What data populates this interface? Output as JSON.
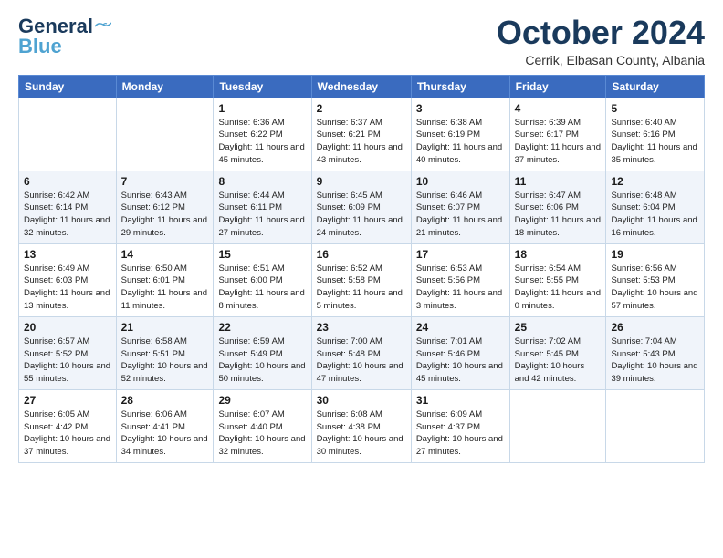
{
  "header": {
    "logo_line1": "General",
    "logo_line2": "Blue",
    "month_title": "October 2024",
    "location": "Cerrik, Elbasan County, Albania"
  },
  "weekdays": [
    "Sunday",
    "Monday",
    "Tuesday",
    "Wednesday",
    "Thursday",
    "Friday",
    "Saturday"
  ],
  "weeks": [
    [
      {
        "day": "",
        "sunrise": "",
        "sunset": "",
        "daylight": ""
      },
      {
        "day": "",
        "sunrise": "",
        "sunset": "",
        "daylight": ""
      },
      {
        "day": "1",
        "sunrise": "Sunrise: 6:36 AM",
        "sunset": "Sunset: 6:22 PM",
        "daylight": "Daylight: 11 hours and 45 minutes."
      },
      {
        "day": "2",
        "sunrise": "Sunrise: 6:37 AM",
        "sunset": "Sunset: 6:21 PM",
        "daylight": "Daylight: 11 hours and 43 minutes."
      },
      {
        "day": "3",
        "sunrise": "Sunrise: 6:38 AM",
        "sunset": "Sunset: 6:19 PM",
        "daylight": "Daylight: 11 hours and 40 minutes."
      },
      {
        "day": "4",
        "sunrise": "Sunrise: 6:39 AM",
        "sunset": "Sunset: 6:17 PM",
        "daylight": "Daylight: 11 hours and 37 minutes."
      },
      {
        "day": "5",
        "sunrise": "Sunrise: 6:40 AM",
        "sunset": "Sunset: 6:16 PM",
        "daylight": "Daylight: 11 hours and 35 minutes."
      }
    ],
    [
      {
        "day": "6",
        "sunrise": "Sunrise: 6:42 AM",
        "sunset": "Sunset: 6:14 PM",
        "daylight": "Daylight: 11 hours and 32 minutes."
      },
      {
        "day": "7",
        "sunrise": "Sunrise: 6:43 AM",
        "sunset": "Sunset: 6:12 PM",
        "daylight": "Daylight: 11 hours and 29 minutes."
      },
      {
        "day": "8",
        "sunrise": "Sunrise: 6:44 AM",
        "sunset": "Sunset: 6:11 PM",
        "daylight": "Daylight: 11 hours and 27 minutes."
      },
      {
        "day": "9",
        "sunrise": "Sunrise: 6:45 AM",
        "sunset": "Sunset: 6:09 PM",
        "daylight": "Daylight: 11 hours and 24 minutes."
      },
      {
        "day": "10",
        "sunrise": "Sunrise: 6:46 AM",
        "sunset": "Sunset: 6:07 PM",
        "daylight": "Daylight: 11 hours and 21 minutes."
      },
      {
        "day": "11",
        "sunrise": "Sunrise: 6:47 AM",
        "sunset": "Sunset: 6:06 PM",
        "daylight": "Daylight: 11 hours and 18 minutes."
      },
      {
        "day": "12",
        "sunrise": "Sunrise: 6:48 AM",
        "sunset": "Sunset: 6:04 PM",
        "daylight": "Daylight: 11 hours and 16 minutes."
      }
    ],
    [
      {
        "day": "13",
        "sunrise": "Sunrise: 6:49 AM",
        "sunset": "Sunset: 6:03 PM",
        "daylight": "Daylight: 11 hours and 13 minutes."
      },
      {
        "day": "14",
        "sunrise": "Sunrise: 6:50 AM",
        "sunset": "Sunset: 6:01 PM",
        "daylight": "Daylight: 11 hours and 11 minutes."
      },
      {
        "day": "15",
        "sunrise": "Sunrise: 6:51 AM",
        "sunset": "Sunset: 6:00 PM",
        "daylight": "Daylight: 11 hours and 8 minutes."
      },
      {
        "day": "16",
        "sunrise": "Sunrise: 6:52 AM",
        "sunset": "Sunset: 5:58 PM",
        "daylight": "Daylight: 11 hours and 5 minutes."
      },
      {
        "day": "17",
        "sunrise": "Sunrise: 6:53 AM",
        "sunset": "Sunset: 5:56 PM",
        "daylight": "Daylight: 11 hours and 3 minutes."
      },
      {
        "day": "18",
        "sunrise": "Sunrise: 6:54 AM",
        "sunset": "Sunset: 5:55 PM",
        "daylight": "Daylight: 11 hours and 0 minutes."
      },
      {
        "day": "19",
        "sunrise": "Sunrise: 6:56 AM",
        "sunset": "Sunset: 5:53 PM",
        "daylight": "Daylight: 10 hours and 57 minutes."
      }
    ],
    [
      {
        "day": "20",
        "sunrise": "Sunrise: 6:57 AM",
        "sunset": "Sunset: 5:52 PM",
        "daylight": "Daylight: 10 hours and 55 minutes."
      },
      {
        "day": "21",
        "sunrise": "Sunrise: 6:58 AM",
        "sunset": "Sunset: 5:51 PM",
        "daylight": "Daylight: 10 hours and 52 minutes."
      },
      {
        "day": "22",
        "sunrise": "Sunrise: 6:59 AM",
        "sunset": "Sunset: 5:49 PM",
        "daylight": "Daylight: 10 hours and 50 minutes."
      },
      {
        "day": "23",
        "sunrise": "Sunrise: 7:00 AM",
        "sunset": "Sunset: 5:48 PM",
        "daylight": "Daylight: 10 hours and 47 minutes."
      },
      {
        "day": "24",
        "sunrise": "Sunrise: 7:01 AM",
        "sunset": "Sunset: 5:46 PM",
        "daylight": "Daylight: 10 hours and 45 minutes."
      },
      {
        "day": "25",
        "sunrise": "Sunrise: 7:02 AM",
        "sunset": "Sunset: 5:45 PM",
        "daylight": "Daylight: 10 hours and 42 minutes."
      },
      {
        "day": "26",
        "sunrise": "Sunrise: 7:04 AM",
        "sunset": "Sunset: 5:43 PM",
        "daylight": "Daylight: 10 hours and 39 minutes."
      }
    ],
    [
      {
        "day": "27",
        "sunrise": "Sunrise: 6:05 AM",
        "sunset": "Sunset: 4:42 PM",
        "daylight": "Daylight: 10 hours and 37 minutes."
      },
      {
        "day": "28",
        "sunrise": "Sunrise: 6:06 AM",
        "sunset": "Sunset: 4:41 PM",
        "daylight": "Daylight: 10 hours and 34 minutes."
      },
      {
        "day": "29",
        "sunrise": "Sunrise: 6:07 AM",
        "sunset": "Sunset: 4:40 PM",
        "daylight": "Daylight: 10 hours and 32 minutes."
      },
      {
        "day": "30",
        "sunrise": "Sunrise: 6:08 AM",
        "sunset": "Sunset: 4:38 PM",
        "daylight": "Daylight: 10 hours and 30 minutes."
      },
      {
        "day": "31",
        "sunrise": "Sunrise: 6:09 AM",
        "sunset": "Sunset: 4:37 PM",
        "daylight": "Daylight: 10 hours and 27 minutes."
      },
      {
        "day": "",
        "sunrise": "",
        "sunset": "",
        "daylight": ""
      },
      {
        "day": "",
        "sunrise": "",
        "sunset": "",
        "daylight": ""
      }
    ]
  ]
}
